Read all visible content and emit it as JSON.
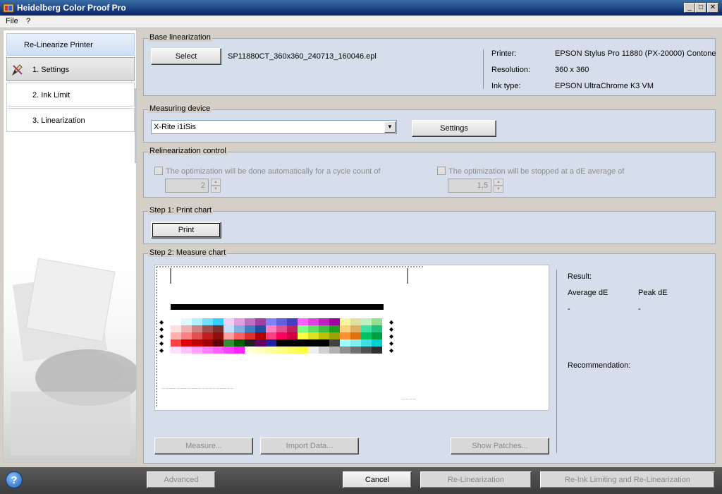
{
  "window": {
    "title": "Heidelberg Color Proof Pro",
    "min": "_",
    "max": "□",
    "close": "✕"
  },
  "menu": {
    "file": "File",
    "help": "?"
  },
  "sidebar": {
    "header": "Re-Linearize Printer",
    "items": [
      {
        "label": "1. Settings"
      },
      {
        "label": "2. Ink Limit"
      },
      {
        "label": "3. Linearization"
      }
    ]
  },
  "base": {
    "title": "Base linearization",
    "select_label": "Select",
    "filename": "SP11880CT_360x360_240713_160046.epl",
    "printer_label": "Printer:",
    "printer_value": "EPSON Stylus Pro 11880 (PX-20000) Contone",
    "resolution_label": "Resolution:",
    "resolution_value": "360 x 360",
    "inktype_label": "Ink type:",
    "inktype_value": "EPSON UltraChrome K3 VM"
  },
  "measuring": {
    "title": "Measuring device",
    "device": "X-Rite i1iSis",
    "settings_label": "Settings"
  },
  "relin": {
    "title": "Relinearization control",
    "cycle_text": "The optimization will be done automatically for a cycle count of",
    "cycle_value": "2",
    "de_text": "The optimization will be stopped at a dE average of",
    "de_value": "1,5"
  },
  "step1": {
    "title": "Step 1: Print chart",
    "print_label": "Print"
  },
  "step2": {
    "title": "Step 2: Measure chart",
    "result_label": "Result:",
    "avg_label": "Average dE",
    "peak_label": "Peak dE",
    "avg_value": "-",
    "peak_value": "-",
    "recommendation_label": "Recommendation:",
    "measure_label": "Measure...",
    "import_label": "Import Data...",
    "show_patches_label": "Show Patches..."
  },
  "footer": {
    "help": "?",
    "advanced_label": "Advanced",
    "cancel_label": "Cancel",
    "relin_label": "Re-Linearization",
    "reink_label": "Re-Ink Limiting and Re-Linearization"
  }
}
